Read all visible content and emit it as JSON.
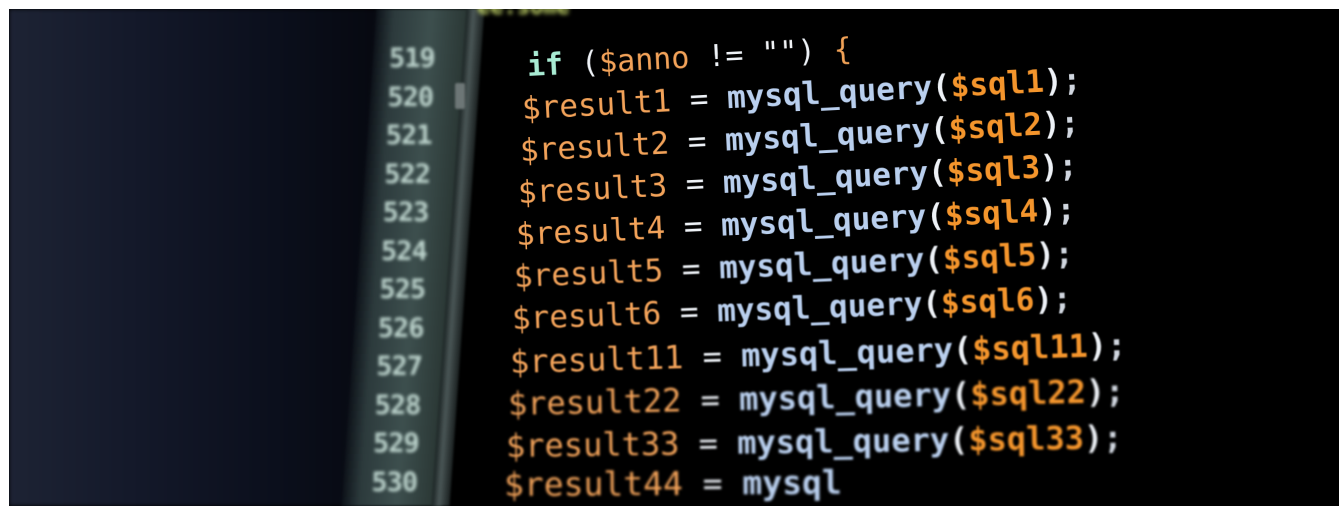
{
  "editor": {
    "top_fragment": "ee.some",
    "line_numbers": [
      "519",
      "520",
      "521",
      "522",
      "523",
      "524",
      "525",
      "526",
      "527",
      "528",
      "529",
      "530"
    ],
    "lines": [
      {
        "kind": "if",
        "keyword": "if",
        "open": " (",
        "var": "$anno",
        "op": " != ",
        "str": "\"\"",
        "close": ") ",
        "brace": "{"
      },
      {
        "kind": "assign",
        "var": "$result1",
        "eq": " = ",
        "fn": "mysql_query",
        "lp": "(",
        "arg": "$sql1",
        "rp": ")",
        "semi": ";"
      },
      {
        "kind": "assign",
        "var": "$result2",
        "eq": " = ",
        "fn": "mysql_query",
        "lp": "(",
        "arg": "$sql2",
        "rp": ")",
        "semi": ";"
      },
      {
        "kind": "assign",
        "var": "$result3",
        "eq": " = ",
        "fn": "mysql_query",
        "lp": "(",
        "arg": "$sql3",
        "rp": ")",
        "semi": ";"
      },
      {
        "kind": "assign",
        "var": "$result4",
        "eq": " = ",
        "fn": "mysql_query",
        "lp": "(",
        "arg": "$sql4",
        "rp": ")",
        "semi": ";"
      },
      {
        "kind": "assign",
        "var": "$result5",
        "eq": " = ",
        "fn": "mysql_query",
        "lp": "(",
        "arg": "$sql5",
        "rp": ")",
        "semi": ";"
      },
      {
        "kind": "assign",
        "var": "$result6",
        "eq": " = ",
        "fn": "mysql_query",
        "lp": "(",
        "arg": "$sql6",
        "rp": ")",
        "semi": ";"
      },
      {
        "kind": "assign",
        "var": "$result11",
        "eq": " = ",
        "fn": "mysql_query",
        "lp": "(",
        "arg": "$sql11",
        "rp": ")",
        "semi": ";"
      },
      {
        "kind": "assign",
        "var": "$result22",
        "eq": " = ",
        "fn": "mysql_query",
        "lp": "(",
        "arg": "$sql22",
        "rp": ")",
        "semi": ";"
      },
      {
        "kind": "assign",
        "var": "$result33",
        "eq": " = ",
        "fn": "mysql_query",
        "lp": "(",
        "arg": "$sql33",
        "rp": ")",
        "semi": ";"
      },
      {
        "kind": "assign",
        "var": "$result44",
        "eq": " = ",
        "fn": "mysql",
        "lp": "",
        "arg": "",
        "rp": "",
        "semi": ""
      }
    ]
  }
}
